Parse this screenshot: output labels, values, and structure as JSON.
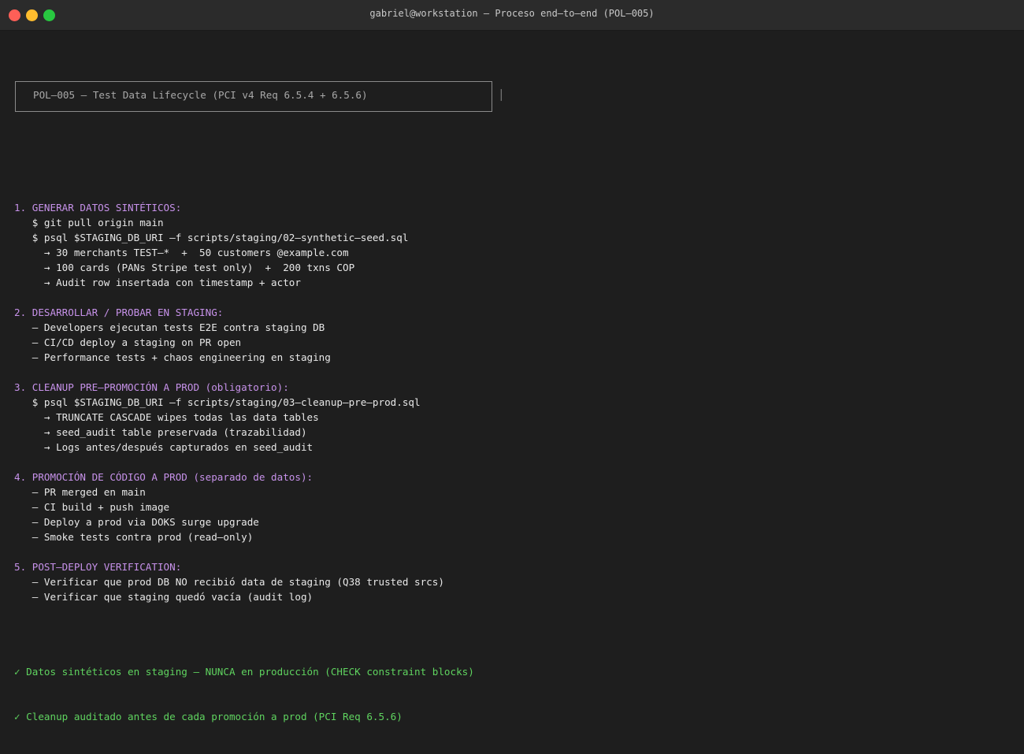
{
  "window": {
    "title": "gabriel@workstation — Proceso end–to–end (POL–005)"
  },
  "banner": {
    "text": "POL–005 — Test Data Lifecycle (PCI v4 Req 6.5.4 + 6.5.6)",
    "edge": "│"
  },
  "sections": [
    {
      "heading": "1. GENERAR DATOS SINTÉTICOS:",
      "lines": [
        "   $ git pull origin main",
        "   $ psql $STAGING_DB_URI –f scripts/staging/02–synthetic–seed.sql",
        "     → 30 merchants TEST–*  +  50 customers @example.com",
        "     → 100 cards (PANs Stripe test only)  +  200 txns COP",
        "     → Audit row insertada con timestamp + actor"
      ]
    },
    {
      "heading": "2. DESARROLLAR / PROBAR EN STAGING:",
      "lines": [
        "   – Developers ejecutan tests E2E contra staging DB",
        "   – CI/CD deploy a staging on PR open",
        "   – Performance tests + chaos engineering en staging"
      ]
    },
    {
      "heading": "3. CLEANUP PRE–PROMOCIÓN A PROD (obligatorio):",
      "lines": [
        "   $ psql $STAGING_DB_URI –f scripts/staging/03–cleanup–pre–prod.sql",
        "     → TRUNCATE CASCADE wipes todas las data tables",
        "     → seed_audit table preservada (trazabilidad)",
        "     → Logs antes/después capturados en seed_audit"
      ]
    },
    {
      "heading": "4. PROMOCIÓN DE CÓDIGO A PROD (separado de datos):",
      "lines": [
        "   – PR merged en main",
        "   – CI build + push image",
        "   – Deploy a prod via DOKS surge upgrade",
        "   – Smoke tests contra prod (read–only)"
      ]
    },
    {
      "heading": "5. POST–DEPLOY VERIFICATION:",
      "lines": [
        "   – Verificar que prod DB NO recibió data de staging (Q38 trusted srcs)",
        "   – Verificar que staging quedó vacía (audit log)"
      ]
    }
  ],
  "footer": [
    "✓ Datos sintéticos en staging — NUNCA en producción (CHECK constraint blocks)",
    "✓ Cleanup auditado antes de cada promoción a prod (PCI Req 6.5.6)"
  ],
  "colors": {
    "heading": "#c792ea",
    "success": "#5fd35f",
    "text": "#e8e8e8",
    "background": "#1e1e1e"
  }
}
